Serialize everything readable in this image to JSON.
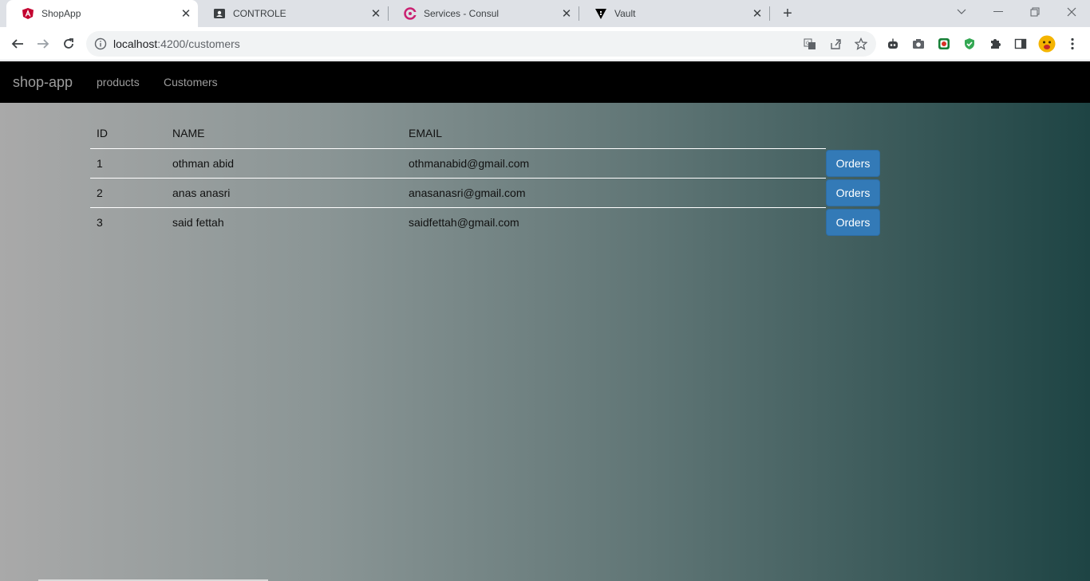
{
  "browser": {
    "tabs": [
      {
        "title": "ShopApp",
        "icon": "angular-icon",
        "active": true
      },
      {
        "title": "CONTROLE",
        "icon": "contact-card-icon",
        "active": false
      },
      {
        "title": "Services - Consul",
        "icon": "consul-icon",
        "active": false
      },
      {
        "title": "Vault",
        "icon": "vault-icon",
        "active": false
      }
    ],
    "url_host": "localhost",
    "url_path": ":4200/customers"
  },
  "app": {
    "brand": "shop-app",
    "nav": [
      "products",
      "Customers"
    ]
  },
  "table": {
    "headers": {
      "id": "ID",
      "name": "NAME",
      "email": "EMAIL"
    },
    "rows": [
      {
        "id": "1",
        "name": "othman abid",
        "email": "othmanabid@gmail.com",
        "action": "Orders"
      },
      {
        "id": "2",
        "name": "anas anasri",
        "email": "anasanasri@gmail.com",
        "action": "Orders"
      },
      {
        "id": "3",
        "name": "said fettah",
        "email": "saidfettah@gmail.com",
        "action": "Orders"
      }
    ]
  },
  "colors": {
    "navbar": "#000000",
    "button": "#337ab7",
    "gradient_start": "#a9a9a9",
    "gradient_end": "#1e4444"
  }
}
